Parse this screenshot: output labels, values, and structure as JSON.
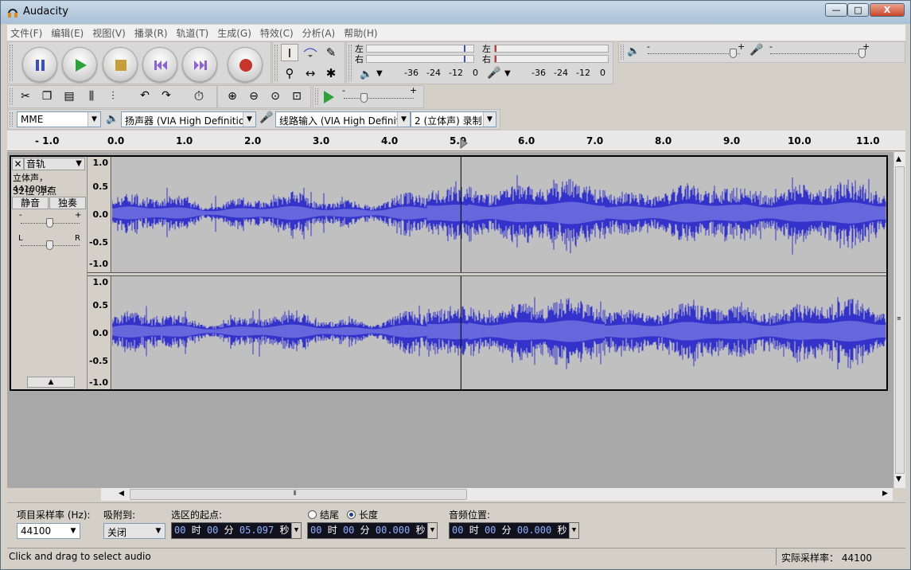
{
  "window": {
    "title": "Audacity",
    "min": "—",
    "max": "□",
    "close": "X"
  },
  "menu": [
    "文件(F)",
    "编辑(E)",
    "视图(V)",
    "播录(R)",
    "轨道(T)",
    "生成(G)",
    "特效(C)",
    "分析(A)",
    "帮助(H)"
  ],
  "meters": {
    "play": {
      "left": "左",
      "right": "右",
      "ticks": [
        "-36",
        "-24",
        "-12",
        "0"
      ]
    },
    "record": {
      "left": "左",
      "right": "右",
      "ticks": [
        "-36",
        "-24",
        "-12",
        "0"
      ]
    },
    "minus": "-",
    "plus": "+"
  },
  "device": {
    "host": "MME",
    "output": "扬声器 (VIA High Definitior",
    "input": "线路输入 (VIA High Definit",
    "channels": "2 (立体声) 录制"
  },
  "ruler": [
    "- 1.0",
    "0.0",
    "1.0",
    "2.0",
    "3.0",
    "4.0",
    "5.0",
    "6.0",
    "7.0",
    "8.0",
    "9.0",
    "10.0",
    "11.0"
  ],
  "track": {
    "close": "✕",
    "name": "音轨",
    "info1": "立体声，44100Hz",
    "info2": "32位 浮点",
    "mute": "静音",
    "solo": "独奏",
    "gain_minus": "-",
    "gain_plus": "+",
    "pan_left": "L",
    "pan_right": "R",
    "scale": [
      "1.0",
      "0.5",
      "0.0",
      "-0.5",
      "-1.0"
    ],
    "gain_level": 0.5,
    "pan_level": 0.5
  },
  "play_volume": 0.93,
  "record_volume": 0.97,
  "play_speed": 0.3,
  "cursor_time": "5.097",
  "selbar": {
    "rate_label": "项目采样率 (Hz):",
    "rate_value": "44100",
    "snap_label": "吸附到:",
    "snap_value": "关闭",
    "start_label": "选区的起点:",
    "end_label": "结尾",
    "length_label": "长度",
    "audio_pos_label": "音频位置:",
    "start_time": {
      "h": "00",
      "hu": "时",
      "m": "00",
      "mu": "分",
      "s": "05.097",
      "su": "秒"
    },
    "length_time": {
      "h": "00",
      "hu": "时",
      "m": "00",
      "mu": "分",
      "s": "00.000",
      "su": "秒"
    },
    "pos_time": {
      "h": "00",
      "hu": "时",
      "m": "00",
      "mu": "分",
      "s": "00.000",
      "su": "秒"
    }
  },
  "status": {
    "left": "Click and drag to select audio",
    "rate_label": "实际采样率：",
    "rate_value": "44100"
  },
  "colors": {
    "wave_outer": "#3333cc",
    "wave_inner": "#6666dd",
    "wave_bg": "#c0c0c0"
  }
}
